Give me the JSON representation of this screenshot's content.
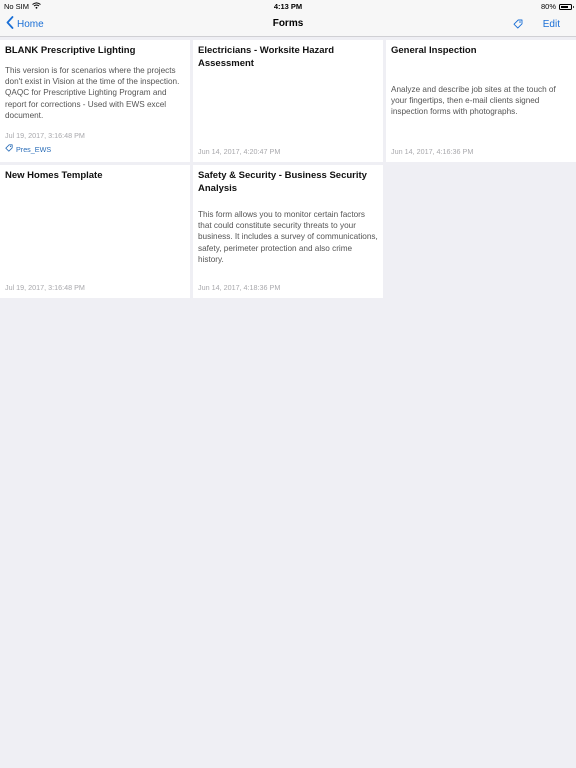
{
  "status_bar": {
    "carrier": "No SIM",
    "time": "4:13 PM",
    "battery": "80%",
    "battery_level": 0.8
  },
  "nav": {
    "back_label": "Home",
    "title": "Forms",
    "edit_label": "Edit"
  },
  "forms": [
    {
      "title": "BLANK Prescriptive Lighting",
      "description": "This version is for scenarios where the projects don't exist in Vision at the time of the inspection. QAQC for Prescriptive Lighting Program and report for corrections - Used with EWS excel document.",
      "date": "Jul 19, 2017, 3:16:48 PM",
      "tag": "Pres_EWS"
    },
    {
      "title": "Electricians - Worksite Hazard Assessment",
      "description": "",
      "date": "Jun 14, 2017, 4:20:47 PM"
    },
    {
      "title": "General Inspection",
      "description": "Analyze and describe job sites at the touch of your fingertips, then e-mail clients signed inspection forms with photographs.",
      "date": "Jun 14, 2017, 4:16:36 PM"
    },
    {
      "title": "New Homes Template",
      "description": "",
      "date": "Jul 19, 2017, 3:16:48 PM"
    },
    {
      "title": "Safety & Security - Business Security Analysis",
      "description": "This form allows you to monitor certain factors that could constitute security threats to your business. It includes a survey of communications, safety, perimeter protection and also crime history.",
      "date": "Jun 14, 2017, 4:18:36 PM"
    }
  ],
  "colors": {
    "accent": "#1a6fd6",
    "background": "#efeff4",
    "card": "#ffffff",
    "tag_text": "#2a6db8"
  }
}
